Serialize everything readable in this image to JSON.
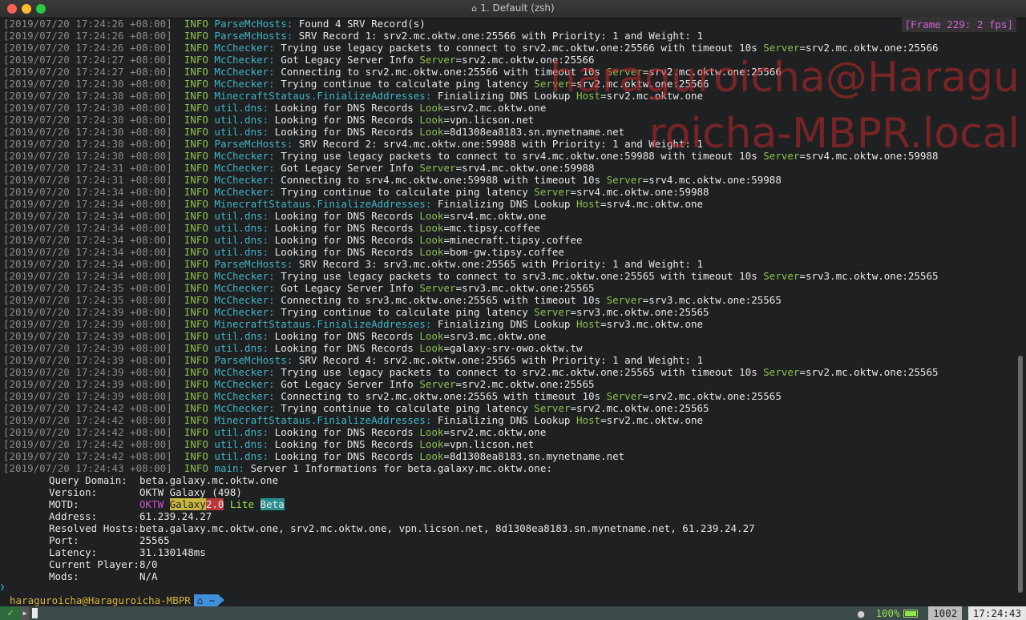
{
  "window": {
    "title": "1. Default (zsh)"
  },
  "frame_badge": "[Frame 229: 2 fps]",
  "watermark": "haraguroicha@Haraguroicha-MBPR.local",
  "log": [
    {
      "ts": "[2019/07/20 17:24:26 +08:00]",
      "mod": "ParseMcHosts:",
      "msg": " Found 4 SRV Record(s)"
    },
    {
      "ts": "[2019/07/20 17:24:26 +08:00]",
      "mod": "ParseMcHosts:",
      "msg": " SRV Record 1: srv2.mc.oktw.one:25566 with Priority: 1 and Weight: 1"
    },
    {
      "ts": "[2019/07/20 17:24:26 +08:00]",
      "mod": "McChecker:",
      "msg": " Trying use legacy packets to connect to srv2.mc.oktw.one:25566 with timeout 10s ",
      "key": "Server",
      "val": "=srv2.mc.oktw.one:25566"
    },
    {
      "ts": "[2019/07/20 17:24:27 +08:00]",
      "mod": "McChecker:",
      "msg": " Got Legacy Server Info ",
      "key": "Server",
      "val": "=srv2.mc.oktw.one:25566"
    },
    {
      "ts": "[2019/07/20 17:24:27 +08:00]",
      "mod": "McChecker:",
      "msg": " Connecting to srv2.mc.oktw.one:25566 with timeout 10s ",
      "key": "Server",
      "val": "=srv2.mc.oktw.one:25566"
    },
    {
      "ts": "[2019/07/20 17:24:30 +08:00]",
      "mod": "McChecker:",
      "msg": " Trying continue to calculate ping latency ",
      "key": "Server",
      "val": "=srv2.mc.oktw.one:25566"
    },
    {
      "ts": "[2019/07/20 17:24:30 +08:00]",
      "mod": "MinecraftStataus.FinializeAddresses:",
      "msg": " Finializing DNS Lookup ",
      "key": "Host",
      "val": "=srv2.mc.oktw.one"
    },
    {
      "ts": "[2019/07/20 17:24:30 +08:00]",
      "mod": "util.dns:",
      "msg": " Looking for DNS Records ",
      "key": "Look",
      "val": "=srv2.mc.oktw.one"
    },
    {
      "ts": "[2019/07/20 17:24:30 +08:00]",
      "mod": "util.dns:",
      "msg": " Looking for DNS Records ",
      "key": "Look",
      "val": "=vpn.licson.net"
    },
    {
      "ts": "[2019/07/20 17:24:30 +08:00]",
      "mod": "util.dns:",
      "msg": " Looking for DNS Records ",
      "key": "Look",
      "val": "=8d1308ea8183.sn.mynetname.net"
    },
    {
      "ts": "[2019/07/20 17:24:30 +08:00]",
      "mod": "ParseMcHosts:",
      "msg": " SRV Record 2: srv4.mc.oktw.one:59988 with Priority: 1 and Weight: 1"
    },
    {
      "ts": "[2019/07/20 17:24:30 +08:00]",
      "mod": "McChecker:",
      "msg": " Trying use legacy packets to connect to srv4.mc.oktw.one:59988 with timeout 10s ",
      "key": "Server",
      "val": "=srv4.mc.oktw.one:59988"
    },
    {
      "ts": "[2019/07/20 17:24:31 +08:00]",
      "mod": "McChecker:",
      "msg": " Got Legacy Server Info ",
      "key": "Server",
      "val": "=srv4.mc.oktw.one:59988"
    },
    {
      "ts": "[2019/07/20 17:24:31 +08:00]",
      "mod": "McChecker:",
      "msg": " Connecting to srv4.mc.oktw.one:59988 with timeout 10s ",
      "key": "Server",
      "val": "=srv4.mc.oktw.one:59988"
    },
    {
      "ts": "[2019/07/20 17:24:34 +08:00]",
      "mod": "McChecker:",
      "msg": " Trying continue to calculate ping latency ",
      "key": "Server",
      "val": "=srv4.mc.oktw.one:59988"
    },
    {
      "ts": "[2019/07/20 17:24:34 +08:00]",
      "mod": "MinecraftStataus.FinializeAddresses:",
      "msg": " Finializing DNS Lookup ",
      "key": "Host",
      "val": "=srv4.mc.oktw.one"
    },
    {
      "ts": "[2019/07/20 17:24:34 +08:00]",
      "mod": "util.dns:",
      "msg": " Looking for DNS Records ",
      "key": "Look",
      "val": "=srv4.mc.oktw.one"
    },
    {
      "ts": "[2019/07/20 17:24:34 +08:00]",
      "mod": "util.dns:",
      "msg": " Looking for DNS Records ",
      "key": "Look",
      "val": "=mc.tipsy.coffee"
    },
    {
      "ts": "[2019/07/20 17:24:34 +08:00]",
      "mod": "util.dns:",
      "msg": " Looking for DNS Records ",
      "key": "Look",
      "val": "=minecraft.tipsy.coffee"
    },
    {
      "ts": "[2019/07/20 17:24:34 +08:00]",
      "mod": "util.dns:",
      "msg": " Looking for DNS Records ",
      "key": "Look",
      "val": "=bom-gw.tipsy.coffee"
    },
    {
      "ts": "[2019/07/20 17:24:34 +08:00]",
      "mod": "ParseMcHosts:",
      "msg": " SRV Record 3: srv3.mc.oktw.one:25565 with Priority: 1 and Weight: 1"
    },
    {
      "ts": "[2019/07/20 17:24:34 +08:00]",
      "mod": "McChecker:",
      "msg": " Trying use legacy packets to connect to srv3.mc.oktw.one:25565 with timeout 10s ",
      "key": "Server",
      "val": "=srv3.mc.oktw.one:25565"
    },
    {
      "ts": "[2019/07/20 17:24:35 +08:00]",
      "mod": "McChecker:",
      "msg": " Got Legacy Server Info ",
      "key": "Server",
      "val": "=srv3.mc.oktw.one:25565"
    },
    {
      "ts": "[2019/07/20 17:24:35 +08:00]",
      "mod": "McChecker:",
      "msg": " Connecting to srv3.mc.oktw.one:25565 with timeout 10s ",
      "key": "Server",
      "val": "=srv3.mc.oktw.one:25565"
    },
    {
      "ts": "[2019/07/20 17:24:39 +08:00]",
      "mod": "McChecker:",
      "msg": " Trying continue to calculate ping latency ",
      "key": "Server",
      "val": "=srv3.mc.oktw.one:25565"
    },
    {
      "ts": "[2019/07/20 17:24:39 +08:00]",
      "mod": "MinecraftStataus.FinializeAddresses:",
      "msg": " Finializing DNS Lookup ",
      "key": "Host",
      "val": "=srv3.mc.oktw.one"
    },
    {
      "ts": "[2019/07/20 17:24:39 +08:00]",
      "mod": "util.dns:",
      "msg": " Looking for DNS Records ",
      "key": "Look",
      "val": "=srv3.mc.oktw.one"
    },
    {
      "ts": "[2019/07/20 17:24:39 +08:00]",
      "mod": "util.dns:",
      "msg": " Looking for DNS Records ",
      "key": "Look",
      "val": "=galaxy-srv-owo.oktw.tw"
    },
    {
      "ts": "[2019/07/20 17:24:39 +08:00]",
      "mod": "ParseMcHosts:",
      "msg": " SRV Record 4: srv2.mc.oktw.one:25565 with Priority: 1 and Weight: 1"
    },
    {
      "ts": "[2019/07/20 17:24:39 +08:00]",
      "mod": "McChecker:",
      "msg": " Trying use legacy packets to connect to srv2.mc.oktw.one:25565 with timeout 10s ",
      "key": "Server",
      "val": "=srv2.mc.oktw.one:25565"
    },
    {
      "ts": "[2019/07/20 17:24:39 +08:00]",
      "mod": "McChecker:",
      "msg": " Got Legacy Server Info ",
      "key": "Server",
      "val": "=srv2.mc.oktw.one:25565"
    },
    {
      "ts": "[2019/07/20 17:24:39 +08:00]",
      "mod": "McChecker:",
      "msg": " Connecting to srv2.mc.oktw.one:25565 with timeout 10s ",
      "key": "Server",
      "val": "=srv2.mc.oktw.one:25565"
    },
    {
      "ts": "[2019/07/20 17:24:42 +08:00]",
      "mod": "McChecker:",
      "msg": " Trying continue to calculate ping latency ",
      "key": "Server",
      "val": "=srv2.mc.oktw.one:25565"
    },
    {
      "ts": "[2019/07/20 17:24:42 +08:00]",
      "mod": "MinecraftStataus.FinializeAddresses:",
      "msg": " Finializing DNS Lookup ",
      "key": "Host",
      "val": "=srv2.mc.oktw.one"
    },
    {
      "ts": "[2019/07/20 17:24:42 +08:00]",
      "mod": "util.dns:",
      "msg": " Looking for DNS Records ",
      "key": "Look",
      "val": "=srv2.mc.oktw.one"
    },
    {
      "ts": "[2019/07/20 17:24:42 +08:00]",
      "mod": "util.dns:",
      "msg": " Looking for DNS Records ",
      "key": "Look",
      "val": "=vpn.licson.net"
    },
    {
      "ts": "[2019/07/20 17:24:42 +08:00]",
      "mod": "util.dns:",
      "msg": " Looking for DNS Records ",
      "key": "Look",
      "val": "=8d1308ea8183.sn.mynetname.net"
    },
    {
      "ts": "[2019/07/20 17:24:43 +08:00]",
      "mod": "main:",
      "msg": " Server 1 Informations for beta.galaxy.mc.oktw.one:"
    }
  ],
  "level_label": "INFO",
  "server_info": [
    {
      "key": "Query Domain:",
      "value": "beta.galaxy.mc.oktw.one"
    },
    {
      "key": "Version:",
      "value": "OKTW Galaxy (498)"
    },
    {
      "key": "MOTD:",
      "value": ""
    },
    {
      "key": "Address:",
      "value": "61.239.24.27"
    },
    {
      "key": "Resolved Hosts:",
      "value": "beta.galaxy.mc.oktw.one, srv2.mc.oktw.one, vpn.licson.net, 8d1308ea8183.sn.mynetname.net, 61.239.24.27"
    },
    {
      "key": "Port:",
      "value": "25565"
    },
    {
      "key": "Latency:",
      "value": "31.130148ms"
    },
    {
      "key": "Current Player:",
      "value": "8/0"
    },
    {
      "key": "Mods:",
      "value": "N/A"
    }
  ],
  "motd": {
    "oktw": "OKTW",
    "galaxy": "Galaxy",
    "ver": "2.0",
    "lite": "Lite",
    "beta": "Beta"
  },
  "prompt": {
    "user_host": "haraguroicha@Haraguroicha-MBPR",
    "dir": "~",
    "dir_icon": "home-icon"
  },
  "statusbar": {
    "check": "✓",
    "battery": "100%",
    "history_num": "1002",
    "time": "17:24:43"
  },
  "colors": {
    "info": "#8fbf4f",
    "module": "#3fb5c4",
    "timestamp": "#8a8a8a",
    "watermark": "#be2828"
  }
}
